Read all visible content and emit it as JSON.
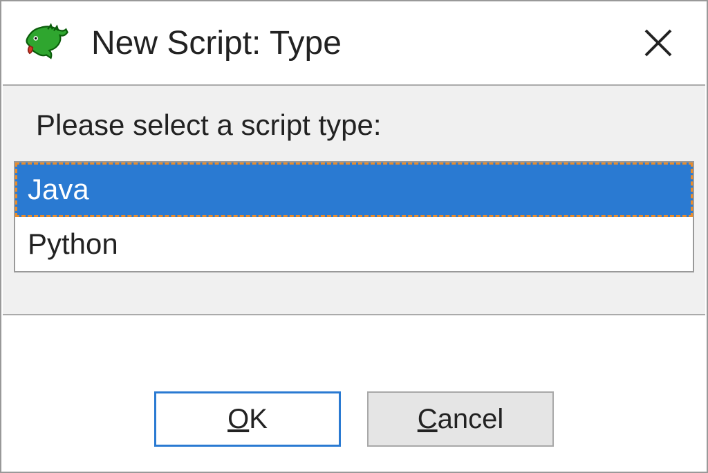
{
  "titlebar": {
    "title": "New Script: Type"
  },
  "body": {
    "prompt": "Please select a script type:",
    "options": [
      {
        "label": "Java",
        "selected": true
      },
      {
        "label": "Python",
        "selected": false
      }
    ]
  },
  "buttons": {
    "ok_mnemonic": "O",
    "ok_rest": "K",
    "cancel_mnemonic": "C",
    "cancel_rest": "ancel"
  }
}
